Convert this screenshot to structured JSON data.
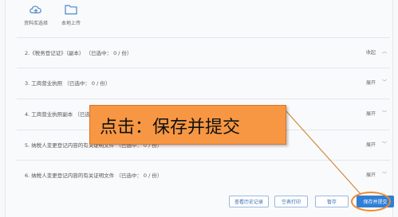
{
  "upload": {
    "library_label": "资料库选择",
    "local_label": "本地上传"
  },
  "rows": [
    {
      "label": "2.《税务登记证》（副本）   （已选中： 0 / 份）",
      "toggle": "收起",
      "arrow": "︿"
    },
    {
      "label": "3. 工商营业执照   （已选中： 0 / 份）",
      "toggle": "展开",
      "arrow": "﹀"
    },
    {
      "label": "4. 工商营业执照副本   （已选中： 0 / 份）",
      "toggle": "展开",
      "arrow": "﹀"
    },
    {
      "label": "5. 纳税人变更登记内容的有关证明文件   （已选中： 0 / 份）",
      "toggle": "展开",
      "arrow": "﹀"
    },
    {
      "label": "6. 纳税人变更登记内容的有关证明文件   （已选中： 0 / 份）",
      "toggle": "展开",
      "arrow": "﹀"
    }
  ],
  "buttons": {
    "history": "查看历史记录",
    "print_blank": "空表打印",
    "save_draft": "暂存",
    "submit": "保存并提交"
  },
  "callout": {
    "text": "点击：保存并提交"
  },
  "colors": {
    "callout_bg": "#f79743",
    "primary": "#2f7fd6",
    "highlight": "#f08a2a"
  }
}
